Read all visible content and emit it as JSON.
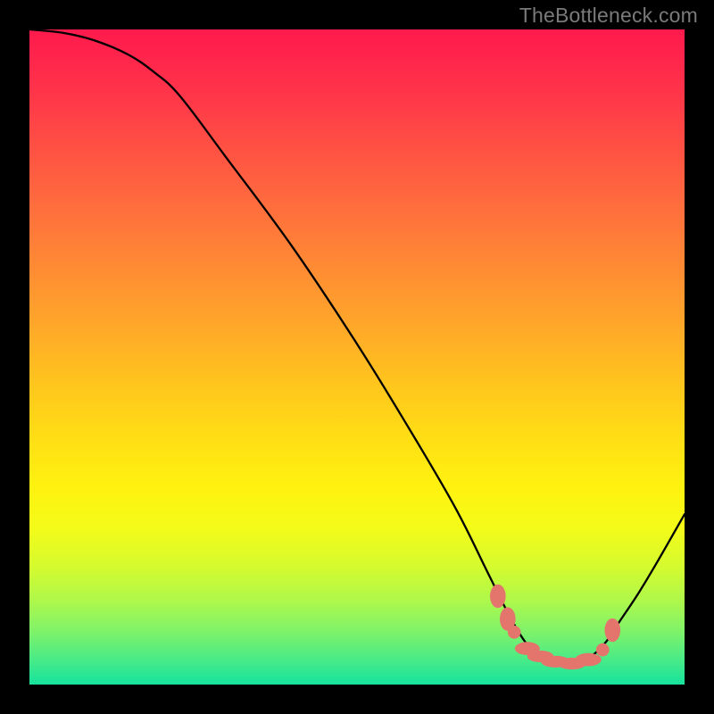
{
  "watermark": "TheBottleneck.com",
  "chart_data": {
    "type": "line",
    "title": "",
    "xlabel": "",
    "ylabel": "",
    "xlim": [
      0,
      100
    ],
    "ylim": [
      0,
      100
    ],
    "curve_note": "Approximate percentage-space trace of the black curve with a minimum valley near x≈78–84.",
    "curve": [
      {
        "x": 0,
        "y": 100
      },
      {
        "x": 5,
        "y": 99.5
      },
      {
        "x": 10,
        "y": 98.3
      },
      {
        "x": 15,
        "y": 96.2
      },
      {
        "x": 19,
        "y": 93.5
      },
      {
        "x": 23,
        "y": 89.8
      },
      {
        "x": 30,
        "y": 80.5
      },
      {
        "x": 40,
        "y": 67
      },
      {
        "x": 50,
        "y": 52
      },
      {
        "x": 58,
        "y": 39
      },
      {
        "x": 65,
        "y": 27
      },
      {
        "x": 70,
        "y": 17
      },
      {
        "x": 73,
        "y": 11
      },
      {
        "x": 75,
        "y": 7.5
      },
      {
        "x": 76.5,
        "y": 5.5
      },
      {
        "x": 78,
        "y": 4.2
      },
      {
        "x": 80,
        "y": 3.4
      },
      {
        "x": 82,
        "y": 3.2
      },
      {
        "x": 84,
        "y": 3.5
      },
      {
        "x": 86,
        "y": 4.5
      },
      {
        "x": 88,
        "y": 6.5
      },
      {
        "x": 90,
        "y": 9.5
      },
      {
        "x": 93,
        "y": 14
      },
      {
        "x": 96,
        "y": 19
      },
      {
        "x": 100,
        "y": 26
      }
    ],
    "markers_note": "Salmon markers along the curve: approximate (x,y) in percentage space and shape.",
    "markers": [
      {
        "x": 71.5,
        "y": 13.5,
        "shape": "ellipse",
        "rx": 1.2,
        "ry": 1.8
      },
      {
        "x": 73.0,
        "y": 10.0,
        "shape": "ellipse",
        "rx": 1.2,
        "ry": 1.8
      },
      {
        "x": 74.0,
        "y": 8.0,
        "shape": "circle",
        "r": 1.0
      },
      {
        "x": 76.0,
        "y": 5.5,
        "shape": "ellipse",
        "rx": 1.9,
        "ry": 1.0
      },
      {
        "x": 78.0,
        "y": 4.3,
        "shape": "ellipse",
        "rx": 2.0,
        "ry": 0.9
      },
      {
        "x": 80.3,
        "y": 3.5,
        "shape": "ellipse",
        "rx": 2.2,
        "ry": 0.9
      },
      {
        "x": 82.8,
        "y": 3.2,
        "shape": "ellipse",
        "rx": 2.2,
        "ry": 0.9
      },
      {
        "x": 85.3,
        "y": 3.8,
        "shape": "ellipse",
        "rx": 2.0,
        "ry": 1.0
      },
      {
        "x": 87.5,
        "y": 5.3,
        "shape": "circle",
        "r": 1.0
      },
      {
        "x": 89.0,
        "y": 8.3,
        "shape": "ellipse",
        "rx": 1.2,
        "ry": 1.8
      }
    ],
    "series_color": "#000000",
    "marker_color": "#e4756d",
    "gradient_stops": [
      {
        "pos": 0,
        "color": "#ff1a4d"
      },
      {
        "pos": 26,
        "color": "#ff6a3e"
      },
      {
        "pos": 55,
        "color": "#ffc81c"
      },
      {
        "pos": 76,
        "color": "#d5fb2e"
      },
      {
        "pos": 100,
        "color": "#15e39e"
      }
    ]
  }
}
